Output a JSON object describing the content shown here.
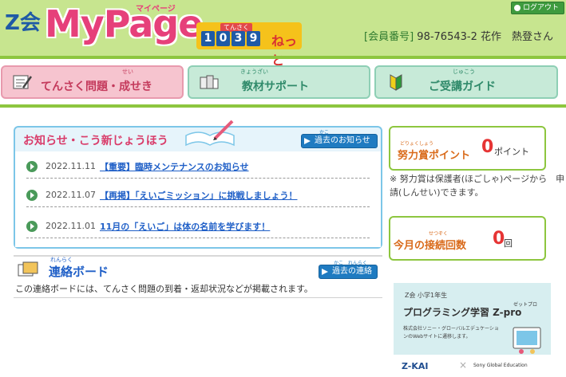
{
  "header": {
    "logo_z": "Z会",
    "logo_mypage": "MyPage",
    "logo_mypage_ruby": "マイページ",
    "logo_1039_ruby": "てんさく",
    "logo_1039_digits": [
      "1",
      "0",
      "3",
      "9"
    ],
    "logo_1039_net": "ねっと",
    "logout_label": "ログアウト",
    "member_label": "[会員番号]",
    "member_number": "98-76543-2",
    "user_name": "花作　熱登さん"
  },
  "nav": {
    "items": [
      {
        "label": "てんさく問題・成せき",
        "ruby": "せい",
        "icon": "pencil-paper-icon"
      },
      {
        "label": "教材サポート",
        "ruby": "きょうざい",
        "icon": "books-icon"
      },
      {
        "label": "ご受講ガイド",
        "ruby": "じゅこう",
        "icon": "beginner-leaf-icon"
      }
    ]
  },
  "news": {
    "title": "お知らせ・こう新じょうほう",
    "past_button": "過去のお知らせ",
    "past_button_ruby": "かこ",
    "items": [
      {
        "date": "2022.11.11",
        "text": "【重要】臨時メンテナンスのお知らせ"
      },
      {
        "date": "2022.11.07",
        "text": "【再掲】「えいごミッション」に挑戦しましょう！"
      },
      {
        "date": "2022.11.01",
        "text": "11月の「えいご」は体の名前を学びます！"
      }
    ]
  },
  "board": {
    "title": "連絡ボード",
    "title_ruby": "れんらく",
    "past_button": "過去の連絡",
    "past_button_ruby": "かこ　れんらく",
    "description": "この連絡ボードには、てんさく問題の到着・返却状況などが掲載されます。"
  },
  "points": {
    "label": "努力賞ポイント",
    "ruby": "どりょくしょう",
    "value": "0",
    "unit": "ポイント",
    "note": "※ 努力賞は保護者(ほごしゃ)ページから　申請(しんせい)できます。"
  },
  "logins": {
    "label": "今月の接続回数",
    "ruby": "せつぞく",
    "value": "0",
    "unit": "回"
  },
  "banner": {
    "grade": "Z会 小学1年生",
    "title": "プログラミング学習 Z-pro",
    "title_ruby": "ゼットプロ",
    "desc": "株式会社ソニー・グローバルエデュケーションのWebサイトに遷移します。",
    "zkai": "Z-KAI",
    "x": "×",
    "sony": "Sony Global Education"
  },
  "colors": {
    "header_bg": "#c7e58f",
    "accent_green": "#8dc63f",
    "news_title": "#d93c6a",
    "link_blue": "#1f5fc7",
    "button_blue": "#1f7bc1",
    "value_red": "#e63434"
  }
}
